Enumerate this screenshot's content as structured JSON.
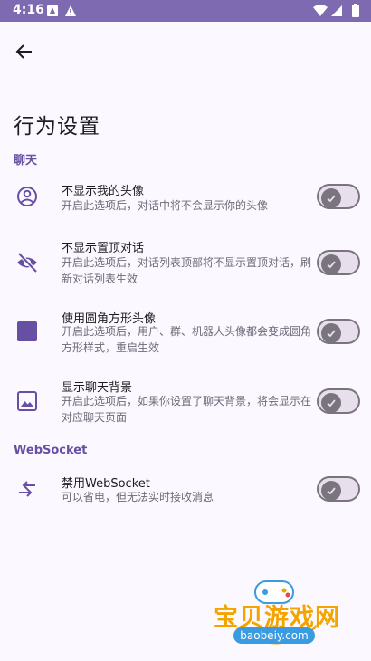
{
  "status_bar": {
    "time": "4:16"
  },
  "page": {
    "title": "行为设置"
  },
  "sections": [
    {
      "header": "聊天",
      "items": [
        {
          "title": "不显示我的头像",
          "desc": "开启此选项后，对话中将不会显示你的头像",
          "icon": "account-circle-icon",
          "enabled": false
        },
        {
          "title": "不显示置顶对话",
          "desc": "开启此选项后，对话列表顶部将不显示置顶对话，刷新对话列表生效",
          "icon": "eye-off-icon",
          "enabled": false
        },
        {
          "title": "使用圆角方形头像",
          "desc": "开启此选项后，用户、群、机器人头像都会变成圆角方形样式，重启生效",
          "icon": "rounded-square-icon",
          "enabled": false
        },
        {
          "title": "显示聊天背景",
          "desc": "开启此选项后，如果你设置了聊天背景，将会显示在对应聊天页面",
          "icon": "image-icon",
          "enabled": false
        }
      ]
    },
    {
      "header": "WebSocket",
      "items": [
        {
          "title": "禁用WebSocket",
          "desc": "可以省电，但无法实时接收消息",
          "icon": "swap-arrows-icon",
          "enabled": false
        }
      ]
    }
  ],
  "colors": {
    "status_bar": "#7E6AB0",
    "accent": "#6750A4",
    "background": "#FCF8FF"
  },
  "watermark": {
    "text": "宝贝游戏网",
    "url": "baobeiy.com"
  }
}
